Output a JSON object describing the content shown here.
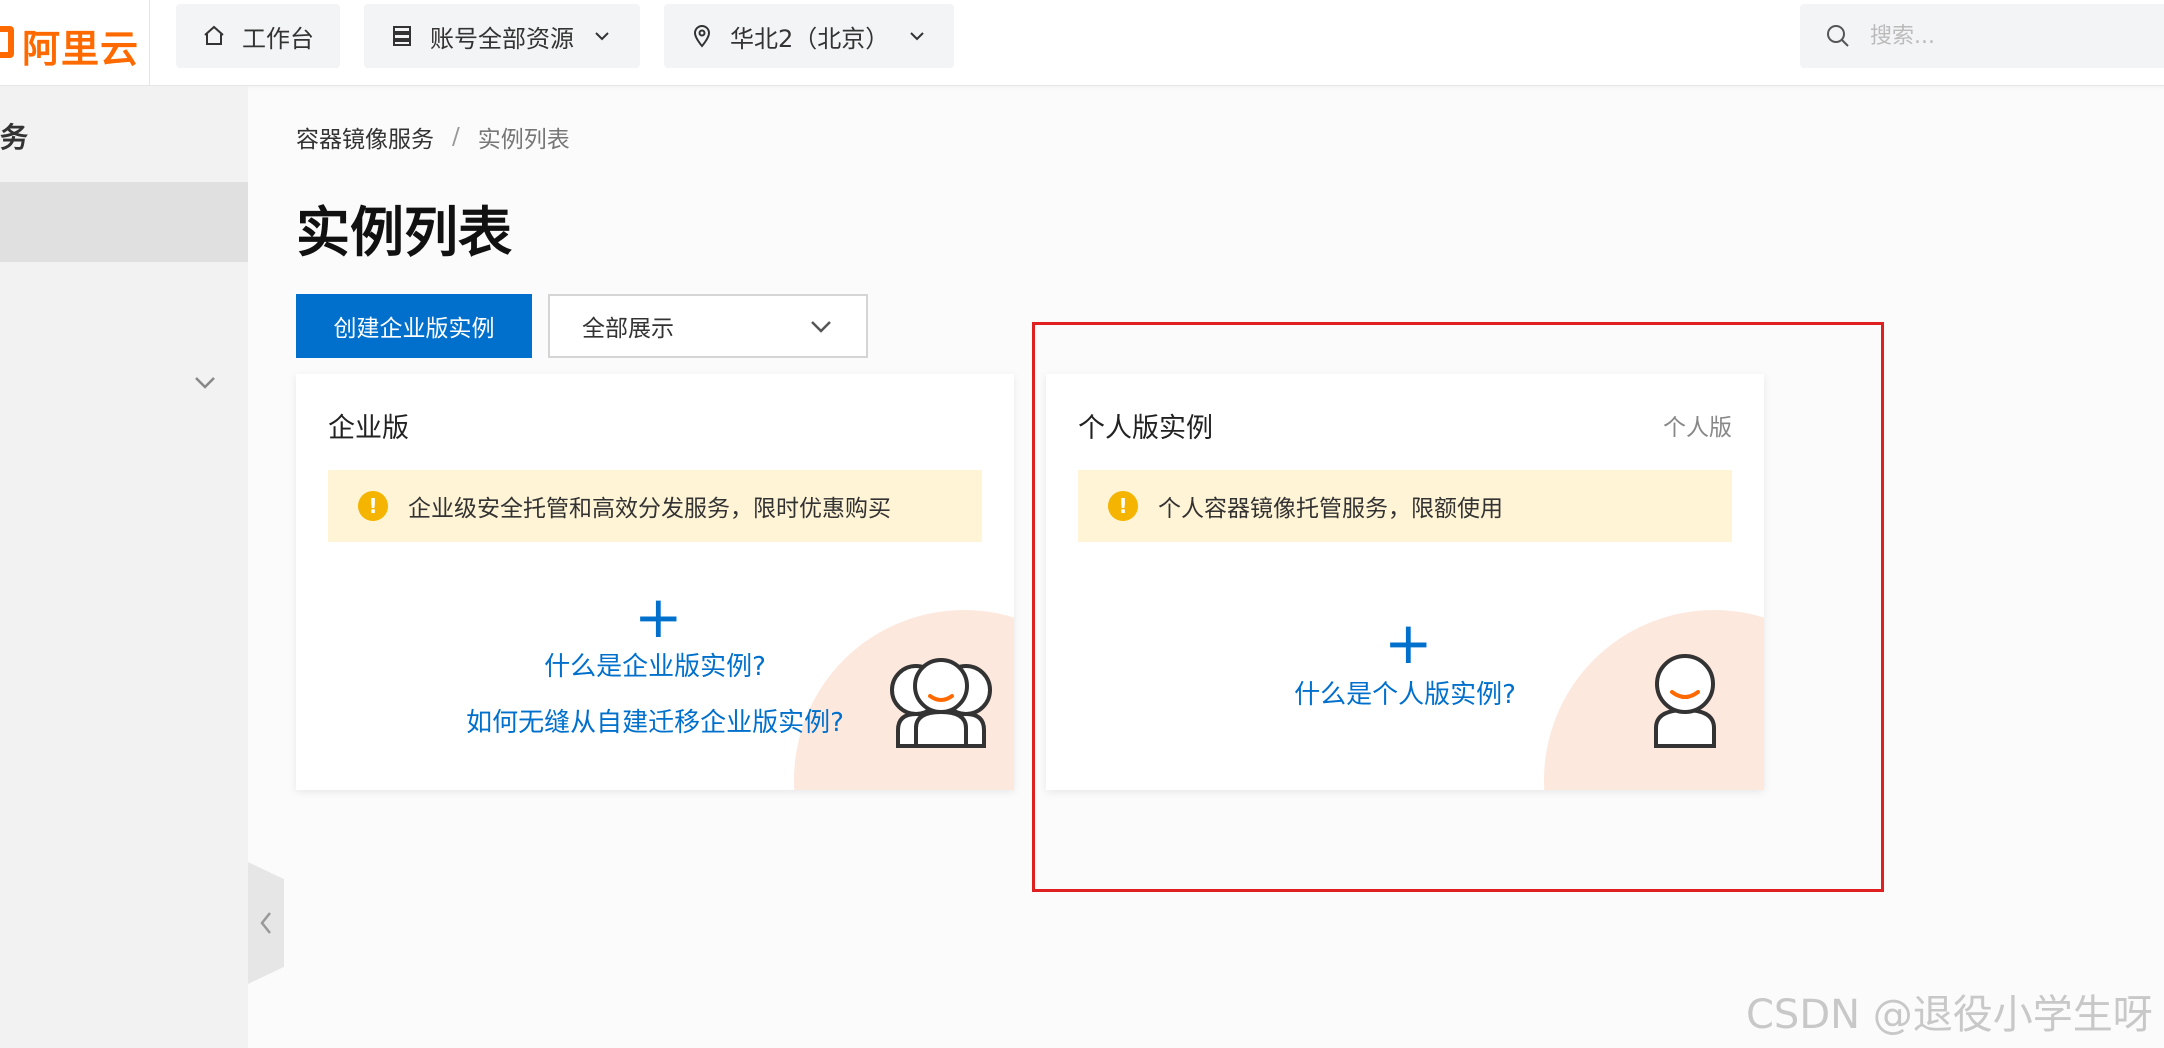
{
  "topbar": {
    "logo_text": "阿里云",
    "workbench_label": "工作台",
    "resources_label": "账号全部资源",
    "region_label": "华北2（北京）",
    "search_placeholder": "搜索..."
  },
  "sidebar": {
    "title": "务"
  },
  "breadcrumb": {
    "parent": "容器镜像服务",
    "separator": "/",
    "current": "实例列表"
  },
  "page": {
    "title": "实例列表",
    "create_button": "创建企业版实例",
    "filter_value": "全部展示"
  },
  "cards": {
    "enterprise": {
      "title": "企业版",
      "notice": "企业级安全托管和高效分发服务，限时优惠购买",
      "plus": "+",
      "link1": "什么是企业版实例?",
      "link2": "如何无缝从自建迁移企业版实例?"
    },
    "personal": {
      "title": "个人版实例",
      "tag": "个人版",
      "notice": "个人容器镜像托管服务，限额使用",
      "plus": "+",
      "link1": "什么是个人版实例?"
    }
  },
  "watermark": "CSDN @退役小学生呀",
  "colors": {
    "brand": "#ff6a00",
    "primary": "#0070cc",
    "notice_bg": "#fff4d6",
    "highlight": "#e02020"
  }
}
